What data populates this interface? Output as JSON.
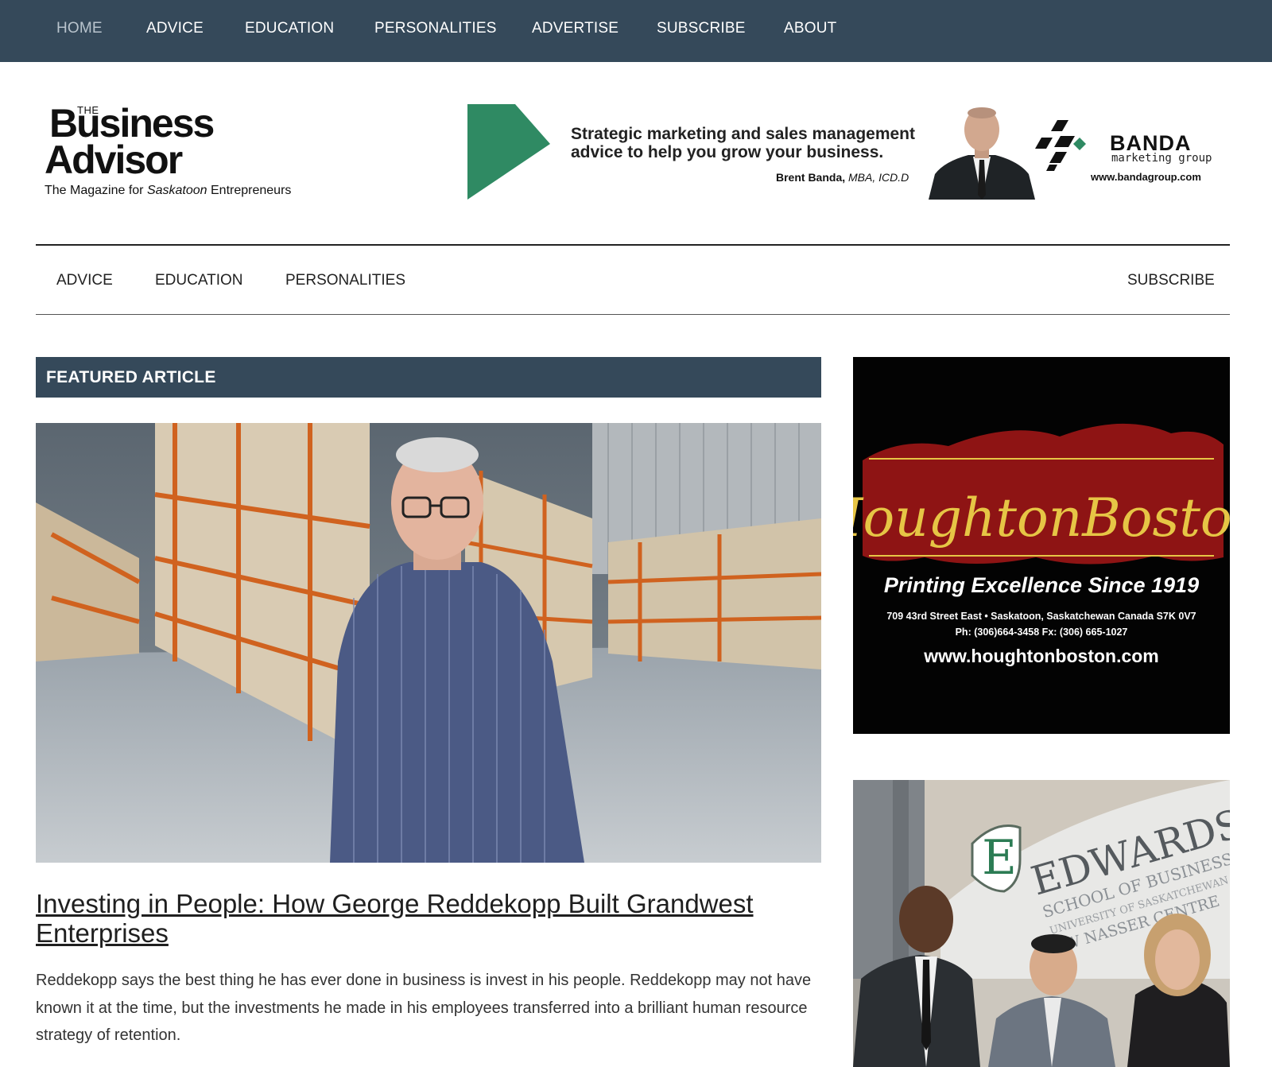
{
  "topnav": {
    "items": [
      "HOME",
      "ADVICE",
      "EDUCATION",
      "PERSONALITIES",
      "ADVERTISE",
      "SUBSCRIBE",
      "ABOUT"
    ],
    "active": "HOME"
  },
  "logo": {
    "the": "THE",
    "line1": "Business",
    "line2": "Advisor",
    "tagline_pre": "The Magazine for ",
    "tagline_city": "Saskatoon",
    "tagline_post": " Entrepreneurs"
  },
  "banner": {
    "line1": "Strategic marketing and sales management",
    "line2": "advice to help you grow your business.",
    "name": "Brent Banda,",
    "credentials": " MBA, ICD.D",
    "brand": "BANDA",
    "brand_sub": "marketing group",
    "url": "www.bandagroup.com"
  },
  "subnav": {
    "left": [
      "ADVICE",
      "EDUCATION",
      "PERSONALITIES"
    ],
    "right": "SUBSCRIBE"
  },
  "featured": {
    "heading": "FEATURED ARTICLE",
    "title": "Investing in People: How George Reddekopp Built Grandwest Enterprises",
    "excerpt": "Reddekopp says the best thing he has ever done in business is invest in his people. Reddekopp may not have known it at the time, but the investments he made in his employees transferred into a brilliant human resource strategy of retention."
  },
  "ads": {
    "houghton": {
      "brand": "HoughtonBoston",
      "slogan": "Printing Excellence Since 1919",
      "address": "709 43rd Street East  • Saskatoon, Saskatchewan Canada S7K 0V7",
      "phone": "Ph: (306)664-3458  Fx: (306) 665-1027",
      "url": "www.houghtonboston.com"
    },
    "edwards": {
      "name": "EDWARDS",
      "school": "SCHOOL OF BUSINESS",
      "university": "UNIVERSITY OF SASKATCHEWAN",
      "centre": "KW NASSER CENTRE"
    }
  },
  "colors": {
    "nav_bg": "#35495a",
    "banner_green": "#2f8a63",
    "houghton_red": "#8e1414",
    "houghton_gold": "#e6c545"
  }
}
